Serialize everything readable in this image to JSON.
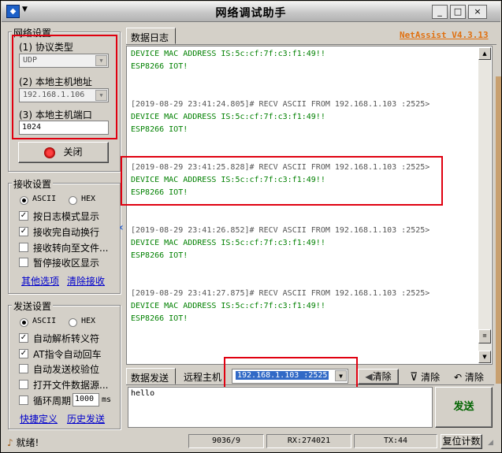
{
  "window": {
    "title": "网络调试助手",
    "menu_glyph": "▼",
    "btn_min": "_",
    "btn_max": "□",
    "btn_close": "×"
  },
  "brand": "NetAssist V4.3.13",
  "net_settings": {
    "title": "网络设置",
    "protocol_label": "(1) 协议类型",
    "protocol_value": "UDP",
    "host_label": "(2) 本地主机地址",
    "host_value": "192.168.1.106",
    "port_label": "(3) 本地主机端口",
    "port_value": "1024",
    "close_button": "关闭"
  },
  "recv_settings": {
    "title": "接收设置",
    "ascii": "ASCII",
    "hex": "HEX",
    "opt1": "按日志模式显示",
    "opt2": "接收完自动换行",
    "opt3": "接收转向至文件...",
    "opt4": "暂停接收区显示",
    "link1": "其他选项",
    "link2": "清除接收"
  },
  "send_settings": {
    "title": "发送设置",
    "ascii": "ASCII",
    "hex": "HEX",
    "opt1": "自动解析转义符",
    "opt2": "AT指令自动回车",
    "opt3": "自动发送校验位",
    "opt4": "打开文件数据源...",
    "opt5": "循环周期",
    "period_value": "1000",
    "period_unit": "ms",
    "link1": "快捷定义",
    "link2": "历史发送"
  },
  "log_tab": "数据日志",
  "log": {
    "l0": "DEVICE MAC ADDRESS IS:5c:cf:7f:c3:f1:49!!",
    "l1": "ESP8266 IOT!",
    "h1": "[2019-08-29 23:41:24.805]# RECV ASCII FROM 192.168.1.103 :2525>",
    "m1": "DEVICE MAC ADDRESS IS:5c:cf:7f:c3:f1:49!!",
    "e1": "ESP8266 IOT!",
    "h2": "[2019-08-29 23:41:25.828]# RECV ASCII FROM 192.168.1.103 :2525>",
    "m2": "DEVICE MAC ADDRESS IS:5c:cf:7f:c3:f1:49!!",
    "e2": "ESP8266 IOT!",
    "h3": "[2019-08-29 23:41:26.852]# RECV ASCII FROM 192.168.1.103 :2525>",
    "m3": "DEVICE MAC ADDRESS IS:5c:cf:7f:c3:f1:49!!",
    "e3": "ESP8266 IOT!",
    "h4": "[2019-08-29 23:41:27.875]# RECV ASCII FROM 192.168.1.103 :2525>",
    "m4": "DEVICE MAC ADDRESS IS:5c:cf:7f:c3:f1:49!!",
    "e4": "ESP8266 IOT!"
  },
  "send_area": {
    "tab_send": "数据发送",
    "tab_remote": "远程主机",
    "remote_value": "192.168.1.103 :2525",
    "clear1": "清除",
    "clear2": "清除",
    "clear3": "清除",
    "text": "hello",
    "send_button": "发送"
  },
  "statusbar": {
    "ready": "就绪!",
    "count": "9036/9",
    "rx": "RX:274021",
    "tx": "TX:44",
    "reset": "复位计数"
  },
  "colors": {
    "log_green": "#008000",
    "log_gray": "#555555",
    "brand_orange": "#e07010",
    "highlight": "#e00010"
  }
}
